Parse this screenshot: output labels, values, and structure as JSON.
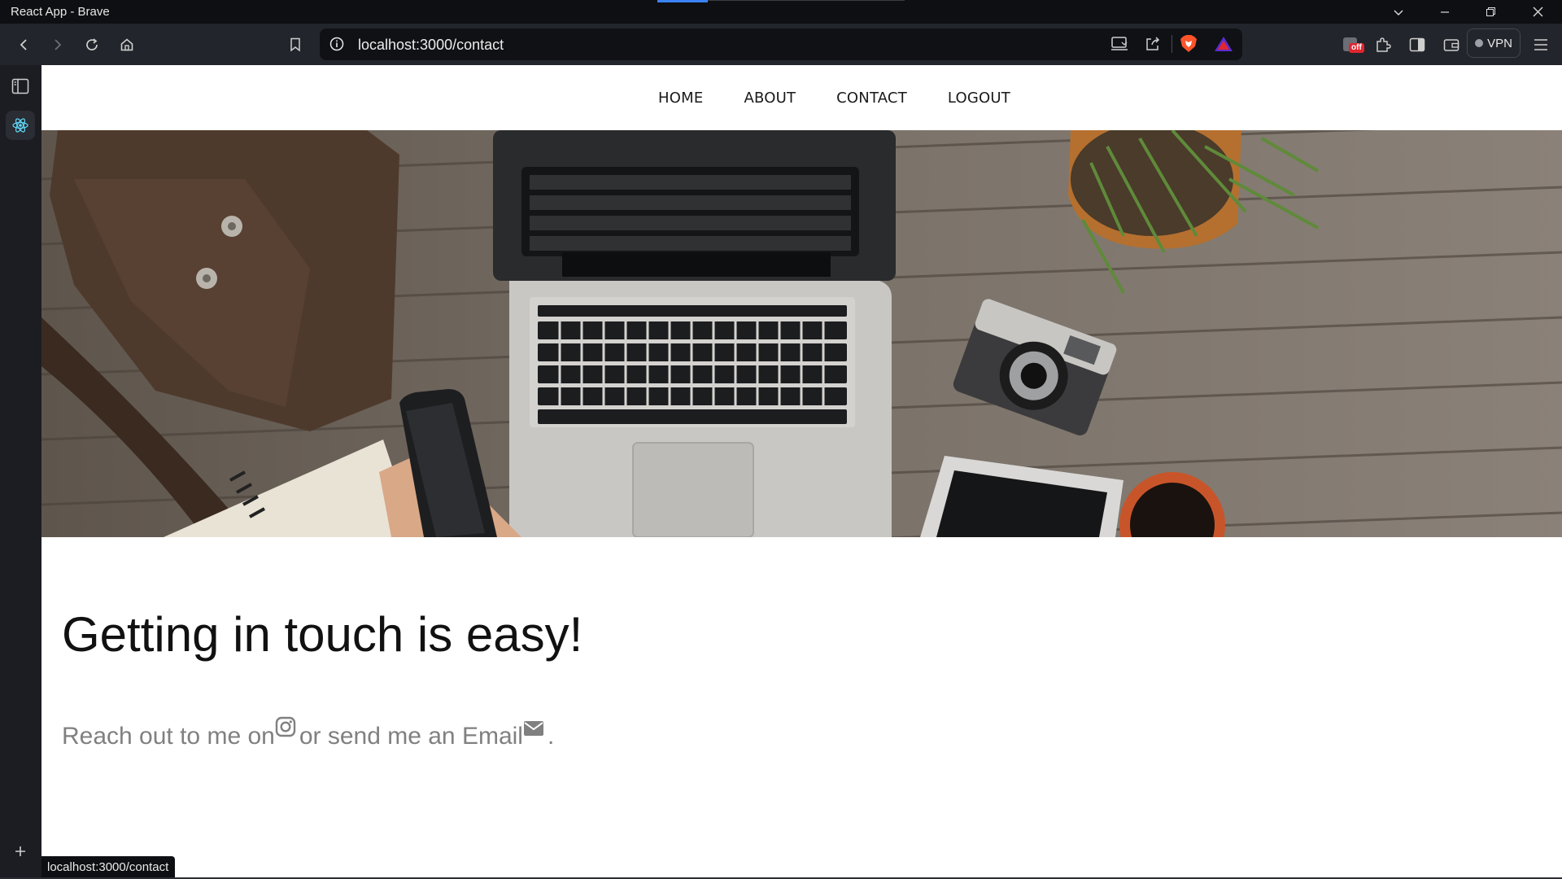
{
  "window": {
    "title": "React App - Brave"
  },
  "browser": {
    "url": "localhost:3000/contact",
    "vpn_label": "VPN",
    "ext_badge": "off"
  },
  "nav": {
    "items": [
      "HOME",
      "ABOUT",
      "CONTACT",
      "LOGOUT"
    ]
  },
  "hero": {
    "description": "desk with laptop, leather bag, phone, camera, plant, coffee"
  },
  "content": {
    "heading": "Getting in touch is easy!",
    "reach_prefix": "Reach out to me on",
    "reach_middle": "or send me an Email",
    "reach_suffix": "."
  },
  "status": {
    "link": "localhost:3000/contact"
  },
  "colors": {
    "accent": "#3b82f6",
    "brave_orange": "#fb542b",
    "brave_red": "#e0262f"
  }
}
